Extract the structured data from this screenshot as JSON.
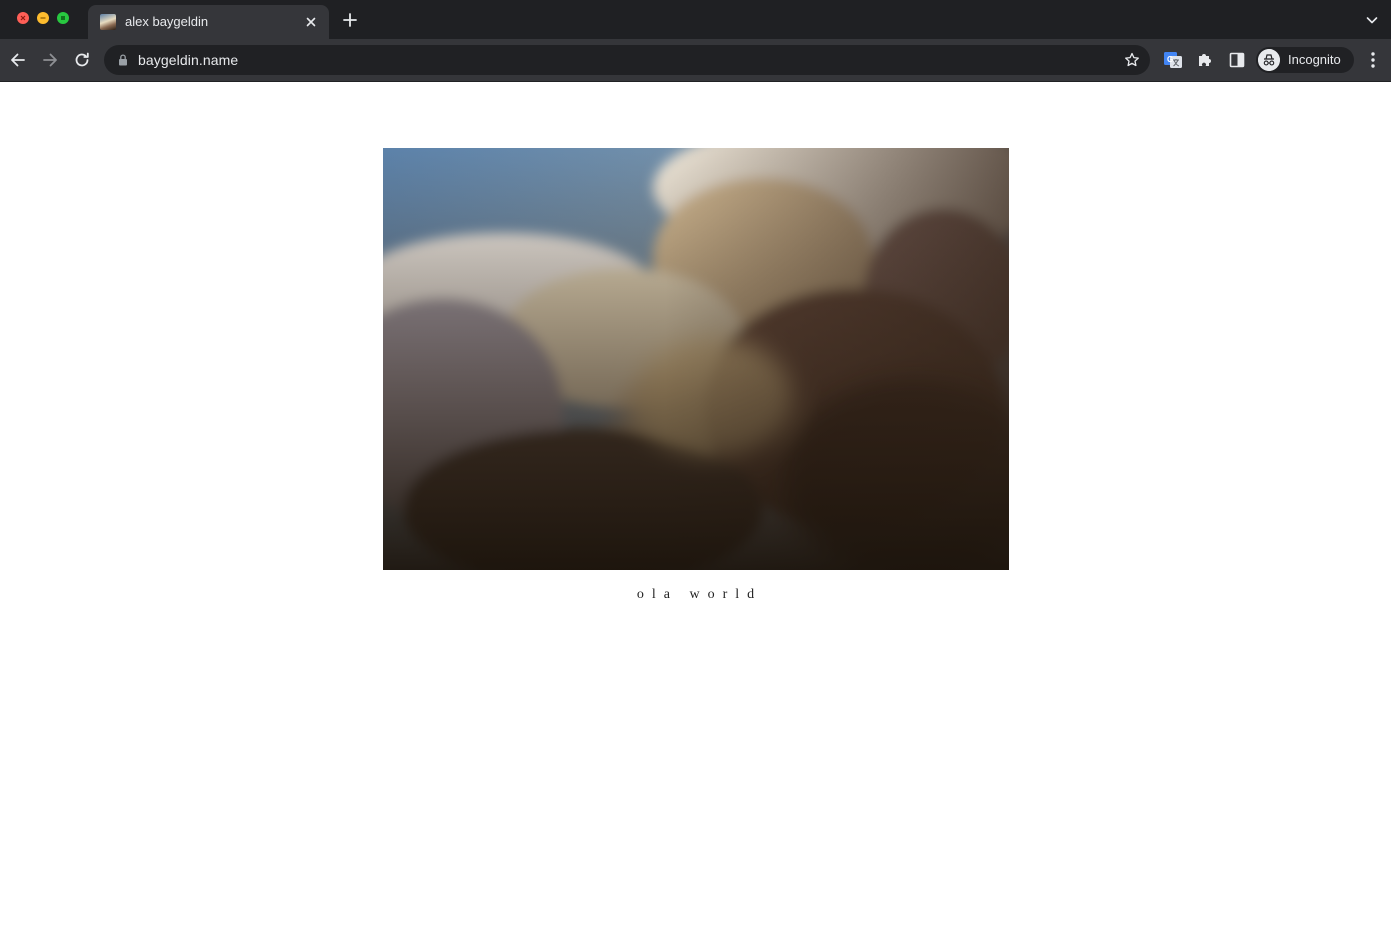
{
  "browser": {
    "tab": {
      "title": "alex baygeldin",
      "favicon": "clouds-photo-favicon"
    },
    "omnibox": {
      "url": "baygeldin.name",
      "secure": true
    },
    "profile": {
      "label": "Incognito"
    },
    "colors": {
      "frame": "#1f2023",
      "toolbar": "#35363a",
      "omnibox": "#202124",
      "text": "#e8eaed"
    }
  },
  "page": {
    "photo": {
      "subject": "cumulus clouds at sunset against a blue sky"
    },
    "caption": "ola world"
  }
}
